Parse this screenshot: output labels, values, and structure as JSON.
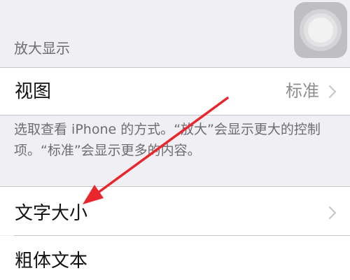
{
  "section": {
    "header": "放大显示"
  },
  "view_row": {
    "label": "视图",
    "value": "标准",
    "chevron_icon": "chevron-right-icon"
  },
  "footer": {
    "text": "选取查看 iPhone 的方式。“放大”会显示更大的控制项。“标准”会显示更多的内容。"
  },
  "text_size_row": {
    "label": "文字大小",
    "chevron_icon": "chevron-right-icon"
  },
  "bold_text_row": {
    "label": "粗体文本"
  },
  "annotation": {
    "color": "#e8262b",
    "icon": "red-arrow"
  },
  "assistive_touch": {
    "icon": "assistive-touch-icon"
  }
}
